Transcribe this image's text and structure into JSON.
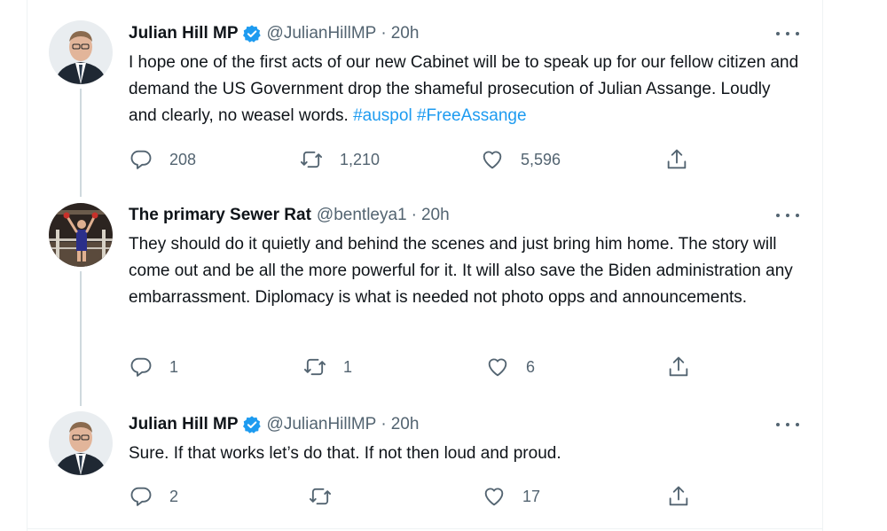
{
  "colors": {
    "link": "#1d9bf0",
    "verified": "#1d9bf0",
    "secondary": "#536471"
  },
  "tweets": [
    {
      "name": "Julian Hill MP",
      "verified": true,
      "handle": "@JulianHillMP",
      "dot": "·",
      "time": "20h",
      "text_parts": [
        "I hope one of the first acts of our new Cabinet will be to speak up for our fellow citizen and demand the US Government drop the shameful prosecution of Julian Assange. Loudly and clearly, no weasel words. ",
        "#auspol",
        " ",
        "#FreeAssange"
      ],
      "replies": "208",
      "retweets": "1,210",
      "likes": "5,596"
    },
    {
      "name": "The primary Sewer Rat",
      "verified": false,
      "handle": "@bentleya1",
      "dot": "·",
      "time": "20h",
      "text": "They should do it quietly and behind the scenes and just bring him home. The story will come out and be all the more powerful for it. It will also save the Biden administration any embarrassment. Diplomacy is what is needed not photo opps and announcements.",
      "replies": "1",
      "retweets": "1",
      "likes": "6"
    },
    {
      "name": "Julian Hill MP",
      "verified": true,
      "handle": "@JulianHillMP",
      "dot": "·",
      "time": "20h",
      "text": "Sure. If that works let’s do that. If not then loud and proud.",
      "replies": "2",
      "retweets": "",
      "likes": "17"
    }
  ]
}
